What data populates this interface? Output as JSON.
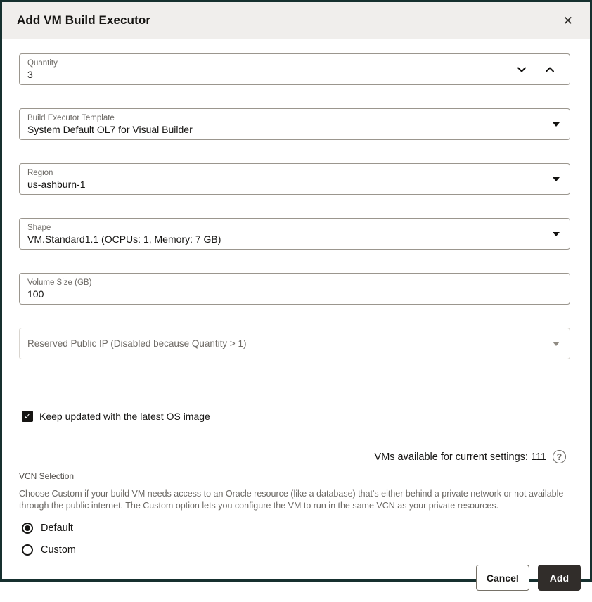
{
  "dialog": {
    "title": "Add VM Build Executor"
  },
  "icons": {
    "close": "✕",
    "checkmark": "✓",
    "help": "?"
  },
  "fields": {
    "quantity": {
      "label": "Quantity",
      "value": "3"
    },
    "template": {
      "label": "Build Executor Template",
      "value": "System Default OL7 for Visual Builder"
    },
    "region": {
      "label": "Region",
      "value": "us-ashburn-1"
    },
    "shape": {
      "label": "Shape",
      "value": "VM.Standard1.1 (OCPUs: 1, Memory: 7 GB)"
    },
    "volume_size": {
      "label": "Volume Size (GB)",
      "value": "100"
    },
    "reserved_ip": {
      "label": "Reserved Public IP (Disabled because Quantity > 1)",
      "disabled": true
    }
  },
  "os_image_checkbox": {
    "label": "Keep updated with the latest OS image",
    "checked": true
  },
  "availability": {
    "text": "VMs available for current settings: 111"
  },
  "vcn": {
    "label": "VCN Selection",
    "description": "Choose Custom if your build VM needs access to an Oracle resource (like a database) that's either behind a private network or not available through the public internet. The Custom option lets you configure the VM to run in the same VCN as your private resources.",
    "options": [
      {
        "label": "Default",
        "selected": true
      },
      {
        "label": "Custom",
        "selected": false
      }
    ]
  },
  "footer": {
    "cancel_label": "Cancel",
    "add_label": "Add"
  },
  "colors": {
    "header_bg": "#f0eeec",
    "outer_border": "#16302f",
    "text": "#161513",
    "label_gray": "#6b6864",
    "field_border": "#9b968e",
    "disabled_border": "#d9d5cf",
    "primary_button": "#312d2a"
  }
}
